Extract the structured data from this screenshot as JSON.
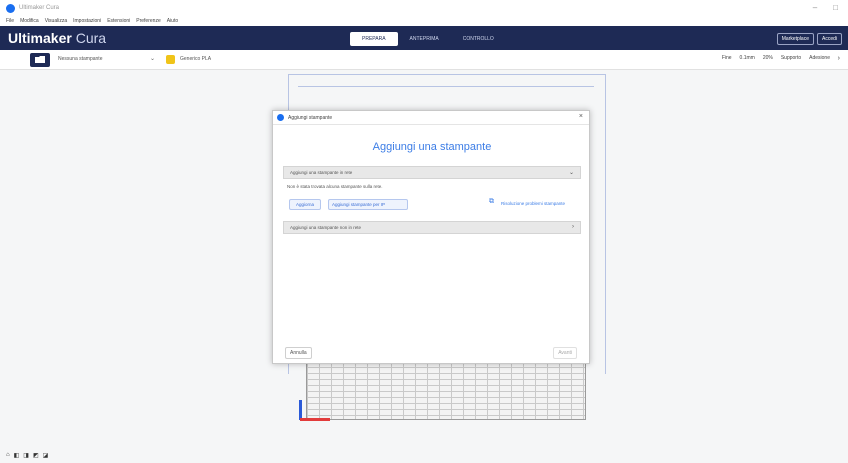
{
  "window": {
    "title": "Ultimaker Cura",
    "controls": [
      "–",
      "□"
    ]
  },
  "menu": [
    "File",
    "Modifica",
    "Visualizza",
    "Impostazioni",
    "Estensioni",
    "Preferenze",
    "Aiuto"
  ],
  "header": {
    "brand_bold": "Ultimaker",
    "brand_light": " Cura",
    "tabs": [
      "PREPARA",
      "ANTEPRIMA",
      "CONTROLLO"
    ],
    "buttons": [
      "Marketplace",
      "Accedi"
    ]
  },
  "toolbar": {
    "printer": "Nessuna stampante",
    "material": "Generico PLA",
    "settings": [
      "Fine",
      "0.1mm",
      "20%",
      "Supporto",
      "Adesione"
    ]
  },
  "dialog": {
    "title": "Aggiungi stampante",
    "heading": "Aggiungi una stampante",
    "section1": "Aggiungi una stampante in rete",
    "info": "Non è stata trovata alcuna stampante sulla rete.",
    "add_button": "Aggiorna",
    "ip_field": "Aggiungi stampante per IP",
    "help_link": "Risoluzione problemi stampante",
    "section2": "Aggiungi una stampante non in rete",
    "cancel": "Annulla",
    "next": "Avanti"
  },
  "bottom_icons": [
    "⌂",
    "◧",
    "◨",
    "◩",
    "◪"
  ]
}
